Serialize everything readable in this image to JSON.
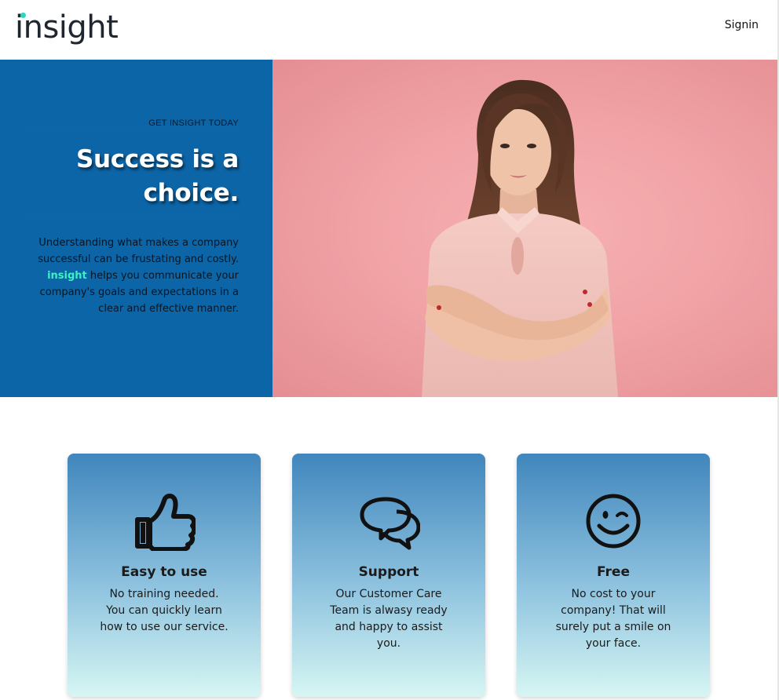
{
  "header": {
    "logo_text": "insight",
    "signin_label": "Signin"
  },
  "hero": {
    "eyebrow": "GET INSIGHT TODAY",
    "headline": "Success is a choice.",
    "description_before": "Understanding what makes a company successful can be frustating and costly. ",
    "description_brand": "insight",
    "description_after": " helps you communicate your company's goals and expectations in a clear and effective manner.",
    "image": "woman-arms-crossed-photo"
  },
  "features": [
    {
      "icon": "thumbs-up-icon",
      "title": "Easy to use",
      "text": "No training needed. You can quickly learn how to use our service."
    },
    {
      "icon": "chat-bubbles-icon",
      "title": "Support",
      "text": "Our Customer Care Team is alwasy ready and happy to assist you."
    },
    {
      "icon": "wink-smiley-icon",
      "title": "Free",
      "text": "No cost to your company! That will surely put a smile on your face."
    }
  ],
  "colors": {
    "hero_blue": "#0c65a7",
    "brand_accent": "#3ef0c6",
    "hero_pink": "#f1a3a6"
  }
}
